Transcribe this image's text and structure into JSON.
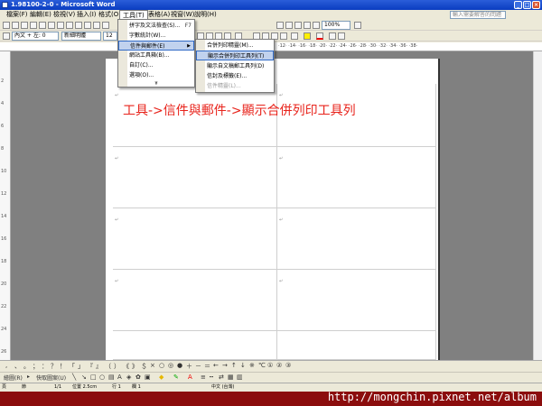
{
  "window": {
    "title": "1.98100-2-0 - Microsoft Word",
    "help_placeholder": "輸入需要解答的問題"
  },
  "menubar": [
    {
      "label": "檔案(F)"
    },
    {
      "label": "編輯(E)"
    },
    {
      "label": "檢視(V)"
    },
    {
      "label": "插入(I)"
    },
    {
      "label": "格式(O)"
    },
    {
      "label": "工具(T)"
    },
    {
      "label": "表格(A)"
    },
    {
      "label": "視窗(W)"
    },
    {
      "label": "說明(H)"
    }
  ],
  "formatting": {
    "style": "內文 + 左: 0",
    "font": "新細明體",
    "size": "12",
    "zoom": "100%"
  },
  "ruler_numbers": "·12· ·14· ·16· ·18· ·20· ·22· ·24· ·26· ·28· ·30· ·32· ·34· ·36· ·38·",
  "left_ruler": [
    "2",
    "4",
    "6",
    "8",
    "10",
    "12",
    "14",
    "16",
    "18",
    "20",
    "22",
    "24",
    "26"
  ],
  "tools_menu": {
    "items": [
      {
        "label": "拼字及文法檢查(S)...",
        "accel": "F7"
      },
      {
        "label": "字數統計(W)..."
      },
      {
        "label": "信件與郵件(E)"
      },
      {
        "label": "網站工具箱(B)..."
      },
      {
        "label": "自訂(C)..."
      },
      {
        "label": "選項(O)..."
      }
    ]
  },
  "mail_submenu": {
    "items": [
      {
        "label": "合併列印精靈(M)..."
      },
      {
        "label": "顯示合併列印工具列(T)"
      },
      {
        "label": "顯示自文稿郵工具列(D)"
      },
      {
        "label": "信封及標籤(E)..."
      },
      {
        "label": "信件精靈(L)..."
      }
    ]
  },
  "annotation": "工具->信件與郵件->顯示合併列印工具列",
  "drawing_toolbar": {
    "draw": "繪圖(R)",
    "autoshapes": "快取圖案(U)"
  },
  "status": {
    "page": "頁",
    "section": "節",
    "position": "1/1",
    "at": "位置 2.5cm",
    "line": "行 1",
    "col": "欄 1",
    "lang": "中文 (台灣)"
  },
  "watermark": "http://mongchin.pixnet.net/album",
  "colors": {
    "annotation": "#e8231b",
    "taskbar": "#8b0d0d",
    "highlight": "#c1d2ee"
  }
}
